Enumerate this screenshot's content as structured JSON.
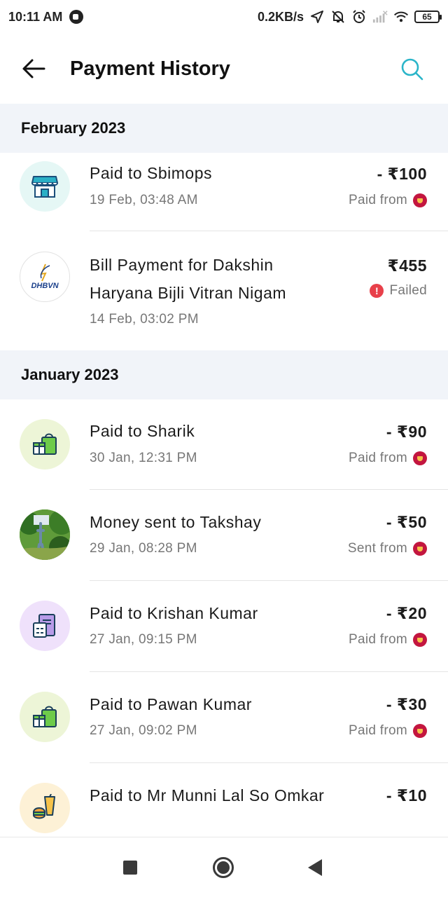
{
  "status_bar": {
    "time": "10:11 AM",
    "network_speed": "0.2KB/s",
    "battery": "65",
    "icons": [
      "record-icon",
      "navigation-icon",
      "mute-bell-icon",
      "alarm-icon",
      "signal-icon",
      "wifi-icon",
      "battery-icon"
    ]
  },
  "header": {
    "title": "Payment History",
    "back_icon": "arrow-left-icon",
    "search_icon": "search-icon",
    "accent_color": "#2bb5c9"
  },
  "sections": [
    {
      "month": "February 2023",
      "transactions": [
        {
          "title": "Paid to Sbimops",
          "date": "19 Feb, 03:48 AM",
          "amount": "- ₹100",
          "subinfo": "Paid from",
          "icon": "store-icon"
        },
        {
          "title": "Bill Payment for Dakshin Haryana Bijli Vitran Nigam",
          "date": "14 Feb, 03:02 PM",
          "amount": "₹455",
          "status": "Failed",
          "icon": "dhbvn-logo",
          "logo_text": "DHBVN"
        }
      ]
    },
    {
      "month": "January 2023",
      "transactions": [
        {
          "title": "Paid to Sharik",
          "date": "30 Jan, 12:31 PM",
          "amount": "- ₹90",
          "subinfo": "Paid from",
          "icon": "shopping-bag-icon"
        },
        {
          "title": "Money sent to Takshay",
          "date": "29 Jan, 08:28 PM",
          "amount": "- ₹50",
          "subinfo": "Sent from",
          "icon": "profile-photo"
        },
        {
          "title": "Paid to Krishan Kumar",
          "date": "27 Jan, 09:15 PM",
          "amount": "- ₹20",
          "subinfo": "Paid from",
          "icon": "bill-document-icon"
        },
        {
          "title": "Paid to Pawan Kumar",
          "date": "27 Jan, 09:02 PM",
          "amount": "- ₹30",
          "subinfo": "Paid from",
          "icon": "shopping-bag-icon"
        },
        {
          "title": "Paid to Mr Munni Lal So Omkar",
          "date": "",
          "amount": "- ₹10",
          "subinfo": "",
          "icon": "food-icon"
        }
      ]
    }
  ],
  "colors": {
    "section_bg": "#f1f4f9",
    "failed": "#e8404a",
    "bank_badge": "#c3163f"
  }
}
